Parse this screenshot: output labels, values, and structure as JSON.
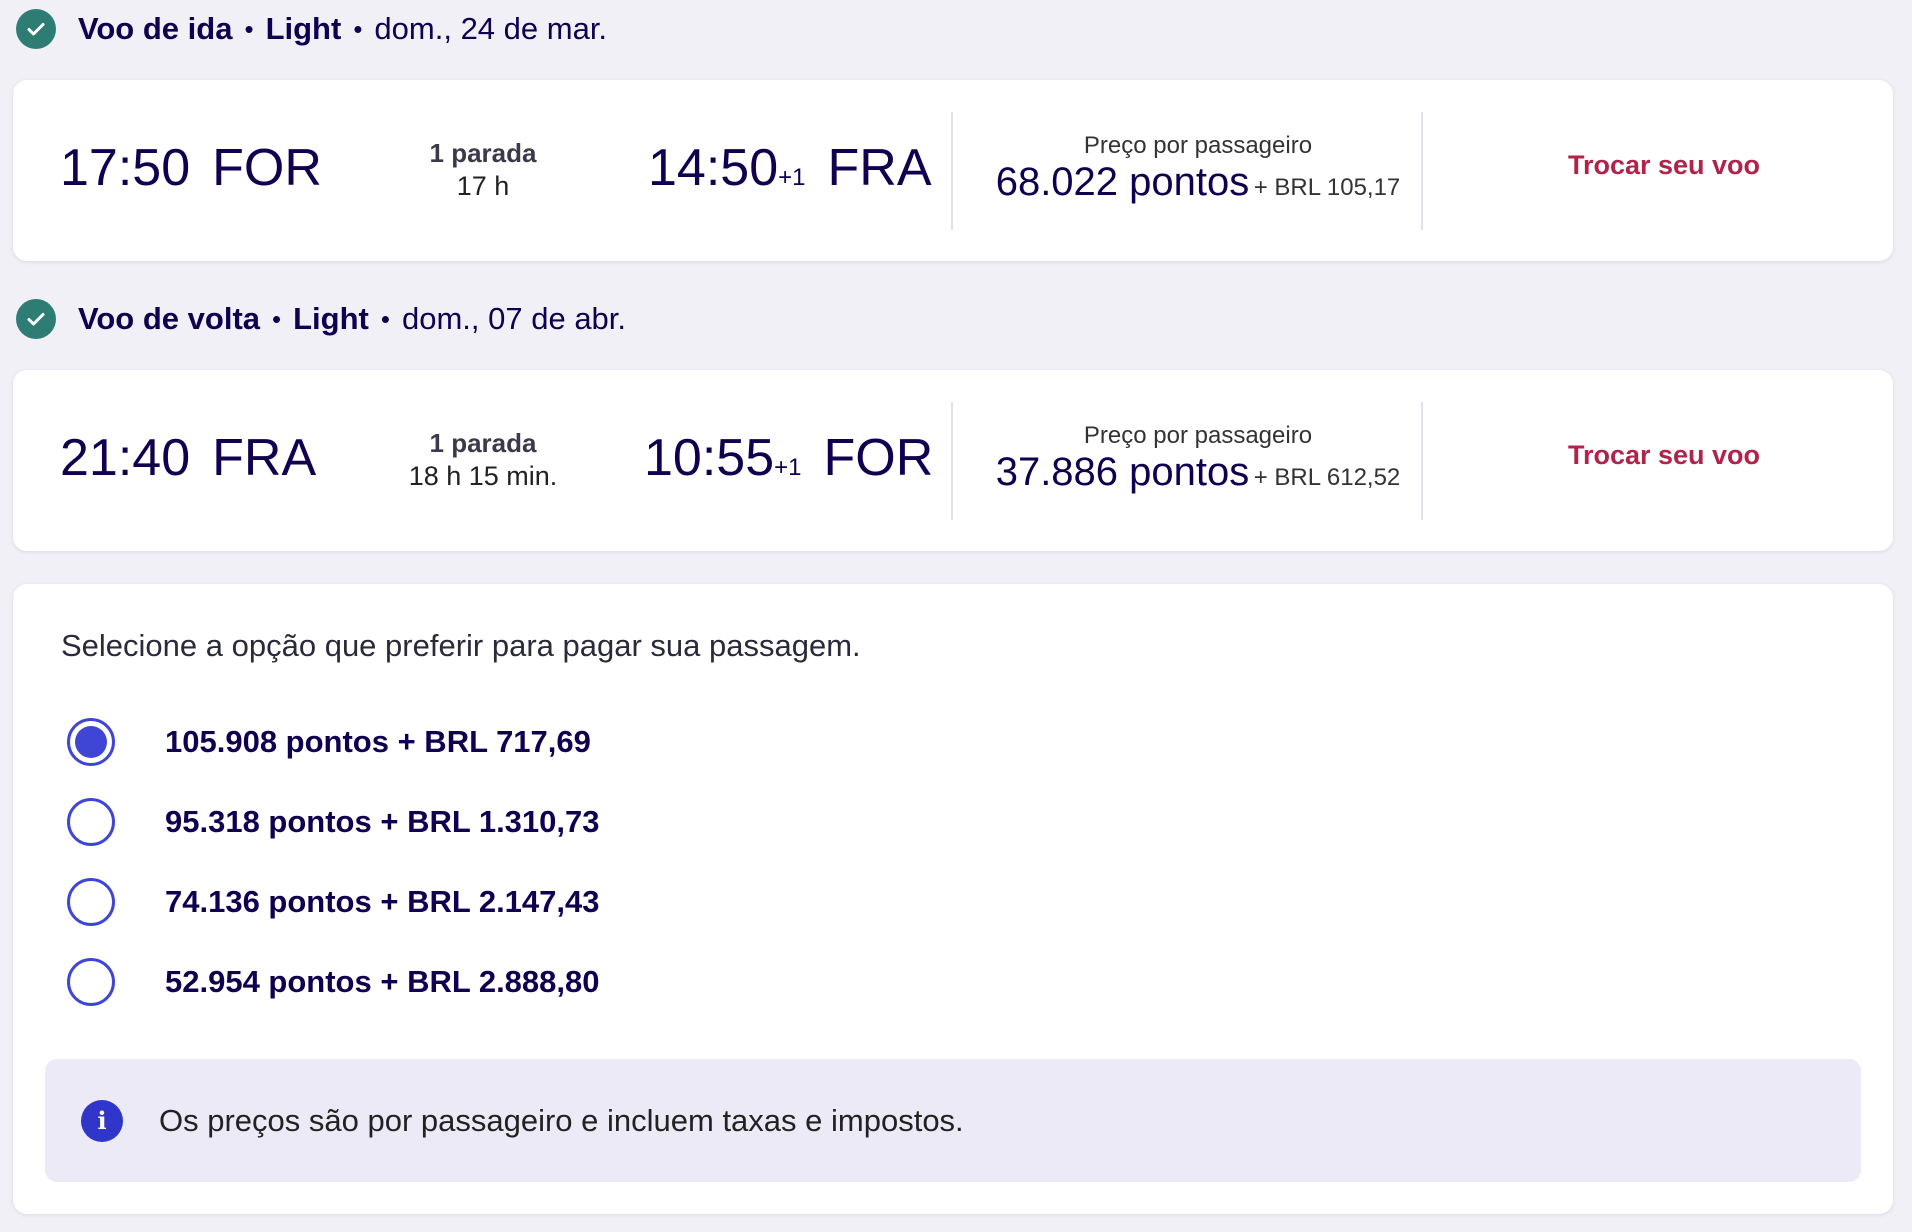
{
  "outbound": {
    "title": "Voo de ida",
    "fare": "Light",
    "date": "dom., 24 de mar.",
    "dep_time": "17:50",
    "dep_code": "FOR",
    "stops": "1 parada",
    "duration": "17 h",
    "arr_time": "14:50",
    "arr_plus": "+1",
    "arr_code": "FRA",
    "price_label": "Preço por passageiro",
    "points": "68.022 pontos",
    "brl": "+ BRL 105,17",
    "change_label": "Trocar seu voo"
  },
  "inbound": {
    "title": "Voo de volta",
    "fare": "Light",
    "date": "dom., 07 de abr.",
    "dep_time": "21:40",
    "dep_code": "FRA",
    "stops": "1 parada",
    "duration": "18 h 15 min.",
    "arr_time": "10:55",
    "arr_plus": "+1",
    "arr_code": "FOR",
    "price_label": "Preço por passageiro",
    "points": "37.886 pontos",
    "brl": "+ BRL 612,52",
    "change_label": "Trocar seu voo"
  },
  "payment": {
    "prompt": "Selecione a opção que preferir para pagar sua passagem.",
    "options": [
      {
        "label": "105.908 pontos + BRL 717,69",
        "selected": true
      },
      {
        "label": "95.318 pontos + BRL 1.310,73",
        "selected": false
      },
      {
        "label": "74.136 pontos + BRL 2.147,43",
        "selected": false
      },
      {
        "label": "52.954 pontos + BRL 2.888,80",
        "selected": false
      }
    ],
    "info": "Os preços são por passageiro e incluem taxas e impostos."
  },
  "colors": {
    "primary": "#10004f",
    "accent": "#3f46d6",
    "check": "#2e7d74",
    "link": "#b0234a"
  }
}
